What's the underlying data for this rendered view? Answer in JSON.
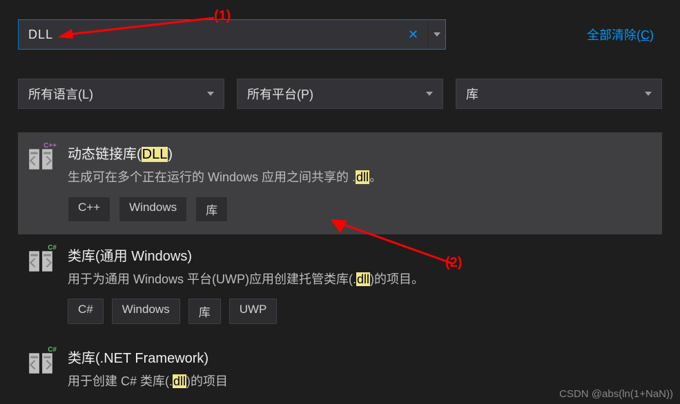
{
  "search": {
    "value": "DLL",
    "clear_all_label": "全部清除(",
    "clear_all_hotkey": "C",
    "clear_all_suffix": ")"
  },
  "filters": {
    "language": "所有语言(L)",
    "platform": "所有平台(P)",
    "type": "库"
  },
  "results": [
    {
      "title_prefix": "动态链接库(",
      "title_hl": "DLL",
      "title_suffix": ")",
      "desc_prefix": "生成可在多个正在运行的 Windows 应用之间共享的 .",
      "desc_hl": "dll",
      "desc_suffix": "。",
      "tags": [
        "C++",
        "Windows",
        "库"
      ],
      "lang_badge": "C++",
      "badge_color": "#b16bbd"
    },
    {
      "title_prefix": "类库(通用 Windows)",
      "title_hl": "",
      "title_suffix": "",
      "desc_prefix": "用于为通用 Windows 平台(UWP)应用创建托管类库(.",
      "desc_hl": "dll",
      "desc_suffix": ")的项目。",
      "tags": [
        "C#",
        "Windows",
        "库",
        "UWP"
      ],
      "lang_badge": "C#",
      "badge_color": "#5fbb5f"
    },
    {
      "title_prefix": "类库(.NET Framework)",
      "title_hl": "",
      "title_suffix": "",
      "desc_prefix": "用于创建 C# 类库(.",
      "desc_hl": "dll",
      "desc_suffix": ")的项目",
      "tags": [],
      "lang_badge": "C#",
      "badge_color": "#5fbb5f"
    }
  ],
  "annotations": {
    "a1": "(1)",
    "a2": "(2)"
  },
  "watermark": "CSDN @abs(ln(1+NaN))"
}
